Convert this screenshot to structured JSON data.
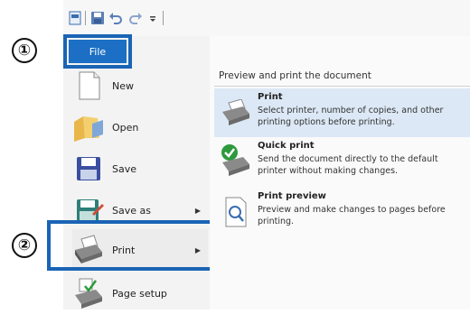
{
  "markers": {
    "step1": "①",
    "step2": "②"
  },
  "ribbon": {
    "file_tab": "File"
  },
  "menu": {
    "items": [
      {
        "label": "New",
        "icon": "new-document-icon"
      },
      {
        "label": "Open",
        "icon": "open-folder-icon"
      },
      {
        "label": "Save",
        "icon": "save-disk-icon"
      },
      {
        "label": "Save as",
        "icon": "save-as-icon",
        "submenu": true
      },
      {
        "label": "Print",
        "icon": "printer-icon",
        "submenu": true
      },
      {
        "label": "Page setup",
        "icon": "page-setup-icon"
      }
    ]
  },
  "submenu": {
    "heading": "Preview and print the document",
    "items": [
      {
        "title": "Print",
        "desc_1": "Select printer, number of copies, and other",
        "desc_2": "printing options before printing."
      },
      {
        "title": "Quick print",
        "desc_1": "Send the document directly to the default",
        "desc_2": "printer without making changes."
      },
      {
        "title": "Print preview",
        "desc_1": "Preview and make changes to pages before",
        "desc_2": "printing."
      }
    ]
  },
  "colors": {
    "highlight": "#1a64b5",
    "file_tab": "#1c6fc4",
    "selected_row": "#dce8f5"
  }
}
